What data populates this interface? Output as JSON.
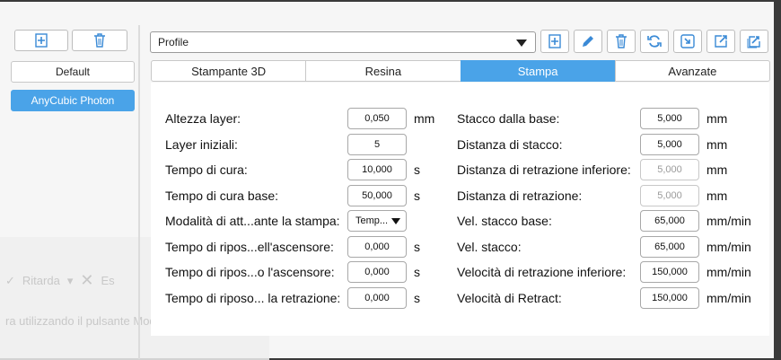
{
  "colors": {
    "accent": "#4aa3e8",
    "window_bg": "#f6f6f6",
    "panel_bg": "#ffffff"
  },
  "left": {
    "add_icon": "plus-document-icon",
    "delete_icon": "trash-icon",
    "presets": [
      "Default",
      "AnyCubic Photon"
    ],
    "active_preset": "AnyCubic Photon"
  },
  "profile": {
    "selected": "Profile"
  },
  "toolbar": [
    "plus-document-icon",
    "pencil-icon",
    "trash-icon",
    "refresh-icon",
    "import-icon",
    "export-icon",
    "export-all-icon"
  ],
  "tabs": [
    "Stampante 3D",
    "Resina",
    "Stampa",
    "Avanzate"
  ],
  "active_tab": "Stampa",
  "left_params": [
    {
      "label": "Altezza layer:",
      "value": "0,050",
      "unit": "mm"
    },
    {
      "label": "Layer iniziali:",
      "value": "5",
      "unit": ""
    },
    {
      "label": "Tempo di cura:",
      "value": "10,000",
      "unit": "s"
    },
    {
      "label": "Tempo di cura base:",
      "value": "50,000",
      "unit": "s"
    },
    {
      "label": "Modalità di att...ante la stampa:",
      "value": "Temp...",
      "unit": "",
      "type": "select"
    },
    {
      "label": "Tempo di ripos...ell'ascensore:",
      "value": "0,000",
      "unit": "s"
    },
    {
      "label": "Tempo di ripos...o l'ascensore:",
      "value": "0,000",
      "unit": "s"
    },
    {
      "label": "Tempo di riposo... la retrazione:",
      "value": "0,000",
      "unit": "s"
    }
  ],
  "right_params": [
    {
      "label": "Stacco dalla base:",
      "value": "5,000",
      "unit": "mm"
    },
    {
      "label": "Distanza di stacco:",
      "value": "5,000",
      "unit": "mm"
    },
    {
      "label": "Distanza di retrazione inferiore:",
      "value": "5,000",
      "unit": "mm",
      "disabled": true
    },
    {
      "label": "Distanza di retrazione:",
      "value": "5,000",
      "unit": "mm",
      "disabled": true
    },
    {
      "label": "Vel. stacco base:",
      "value": "65,000",
      "unit": "mm/min"
    },
    {
      "label": "Vel. stacco:",
      "value": "65,000",
      "unit": "mm/min"
    },
    {
      "label": "Velocità di retrazione inferiore:",
      "value": "150,000",
      "unit": "mm/min"
    },
    {
      "label": "Velocità di Retract:",
      "value": "150,000",
      "unit": "mm/min"
    }
  ],
  "background": {
    "toolbar_items": [
      "Ritarda",
      "Es"
    ],
    "text": "ra utilizzando il pulsante Modalità o",
    "help": "?"
  }
}
